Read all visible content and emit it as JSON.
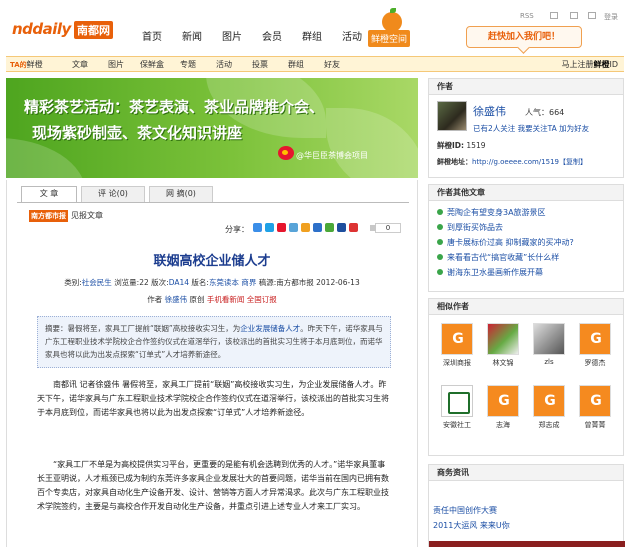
{
  "header": {
    "logo_en": "nddaily",
    "logo_cn": "南都网",
    "nav": [
      "首页",
      "新闻",
      "图片",
      "会员",
      "群组",
      "活动"
    ],
    "xiancheng_label": "鲜橙空间",
    "util_rss": "RSS",
    "util_logout": "登录",
    "join_button": "赶快加入我们吧！"
  },
  "subnav": {
    "tag_prefix": "TA的",
    "tag_label": "鲜橙",
    "items": [
      "文章",
      "图片",
      "保鲜盒",
      "专题",
      "活动",
      "投票",
      "群组",
      "好友"
    ],
    "register_prefix": "马上注册",
    "register_bold": "鲜橙",
    "register_suffix": "ID"
  },
  "banner": {
    "line1": "精彩茶艺活动：茶艺表演、茶业品牌推介会、",
    "line2": "现场紫砂制壶、茶文化知识讲座",
    "weibo": "@华巨臣茶博会项目"
  },
  "article": {
    "tabs": [
      {
        "label": "文 章"
      },
      {
        "label": "评 论",
        "count": "(0)"
      },
      {
        "label": "网 摘",
        "count": "(0)"
      }
    ],
    "source_badge": "南方都市报",
    "source_text": "见报文章",
    "share_label": "分享：",
    "share_count": "0",
    "title": "联姻高校企业储人才",
    "meta": {
      "category_label": "类别:",
      "category": "社会民生",
      "views_label": "浏览量:",
      "views": "22",
      "edition_label": "版次:",
      "edition": "DA14",
      "section_label": "版名:",
      "section": "东莞读本 商界",
      "source_label": "稿源:",
      "source": "南方都市报",
      "date": "2012-06-13"
    },
    "author": {
      "prefix": "作者",
      "name": "徐盛伟",
      "original": "原创",
      "mobile": "手机看新闻",
      "subscribe": "全国订报"
    },
    "summary_prefix": "摘要：暑假将至，家具工厂提前“联姻”高校接收实习生，为",
    "summary_link": "企业发展储备人才",
    "summary_rest": "。昨天下午，诺华家具与广东工程职业技术学院校企合作签约仪式在道滘举行，该校派出的首批实习生将于本月底到位，而诺华家具也将以此为出发点探索“订单式”人才培养新途径。",
    "para1": "南都讯 记者徐盛伟 暑假将至，家具工厂提前“联姻”高校接收实习生，为企业发展储备人才。昨天下午，诺华家具与广东工程职业技术学院校企合作签约仪式在道滘举行，该校派出的首批实习生将于本月底到位，而诺华家具也将以此为出发点探索“订单式”人才培养新途径。",
    "para2": "“家具工厂不单是为高校提供实习平台，更重要的是能有机会选聘到优秀的人才。”诺华家具董事长王亚明说，人才瓶颈已成为制约东莞许多家具企业发展壮大的首要问题，诺华当前在国内已拥有数百个专卖店，对家具自动化生产设备开发、设计、营销等方面人才异常渴求。此次与广东工程职业技术学院签约，主要是与高校合作开发自动化生产设备，并重点引进上述专业人才来工厂实习。"
  },
  "sidebar": {
    "author_box": {
      "header": "作者",
      "name": "徐盛伟",
      "popularity": "人气：664",
      "follow_text": "已有2人关注 我要关注TA  加为好友",
      "id_label": "鲜橙ID:",
      "id_value": "1519",
      "addr_label": "鲜橙地址：",
      "addr_url": "http://g.oeeee.com/1519",
      "addr_copy": "【复制】"
    },
    "other_articles": {
      "header": "作者其他文章",
      "items": [
        "莞陶企有望变身3A旅游景区",
        "到厚街买饰品去",
        "唐卡展标价过高  抑制藏家的买冲动?",
        "来看看古代“搞官收藏”长什么样",
        "谢海东卫水墨画新作展开幕"
      ]
    },
    "related": {
      "header": "相似作者",
      "people": [
        {
          "name": "深圳商报",
          "pic": "g"
        },
        {
          "name": "林文锦",
          "pic": "photo1"
        },
        {
          "name": "zls",
          "pic": "photo2"
        },
        {
          "name": "罗德杰",
          "pic": "g"
        },
        {
          "name": "安徽社工",
          "pic": "photo3"
        },
        {
          "name": "志海",
          "pic": "g"
        },
        {
          "name": "郑志成",
          "pic": "g"
        },
        {
          "name": "曾菁菁",
          "pic": "g"
        }
      ]
    },
    "news": {
      "header": "商务资讯",
      "items": [
        "责任中国创作大赛",
        "2011大运风  来来U你"
      ]
    }
  },
  "colors": {
    "brand": "#e8600a",
    "link": "#1c4fa5",
    "banner_green": "#5cae2a"
  }
}
